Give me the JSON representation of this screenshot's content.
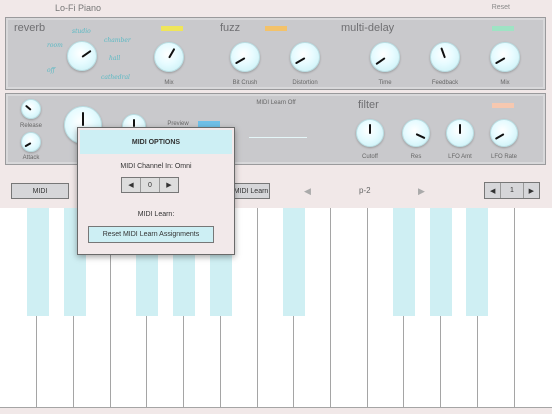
{
  "app": {
    "title": "Lo-Fi Piano",
    "reset_label": "Reset"
  },
  "colors": {
    "accent_yellow": "#efe55a",
    "accent_orange": "#f3c26a",
    "accent_green": "#9fe3c4",
    "accent_blue": "#6fc0e8",
    "accent_peach": "#f6c8b0"
  },
  "reverb": {
    "title": "reverb",
    "options": [
      "studio",
      "chamber",
      "room",
      "hall",
      "off",
      "cathedral"
    ]
  },
  "fuzz": {
    "title": "fuzz"
  },
  "delay": {
    "title": "multi-delay"
  },
  "filter": {
    "title": "filter"
  },
  "knobs": {
    "reverb_mix": "Mix",
    "bit_crush": "Bit Crush",
    "distortion": "Distortion",
    "time": "Time",
    "feedback": "Feedback",
    "delay_mix": "Mix",
    "release": "Release",
    "attack": "Attack",
    "cutoff": "Cutoff",
    "res": "Res",
    "lfo_amt": "LFO Amt",
    "lfo_rate": "LFO Rate"
  },
  "preview_label": "Preview",
  "midi_learn_status": "MIDI Learn Off",
  "controls": {
    "midi_button": "MIDI",
    "midi_learn_button": "MIDI Learn",
    "prev_arrow": "◀",
    "next_arrow": "▶",
    "preset_name": "p-2",
    "octave_value": "1",
    "octave_down": "◀",
    "octave_up": "▶"
  },
  "midi_modal": {
    "title": "MIDI OPTIONS",
    "channel_label": "MIDI Channel In: Omni",
    "channel_value": "0",
    "dec": "◀",
    "inc": "▶",
    "learn_label": "MIDI Learn:",
    "reset_button": "Reset MIDI Learn Assignments"
  }
}
